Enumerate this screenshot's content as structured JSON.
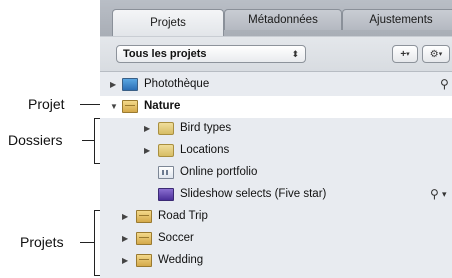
{
  "annotations": {
    "projet": "Projet",
    "dossiers": "Dossiers",
    "projets": "Projets"
  },
  "tabs": [
    {
      "label": "Projets",
      "active": true
    },
    {
      "label": "Métadonnées",
      "active": false
    },
    {
      "label": "Ajustements",
      "active": false
    }
  ],
  "toolbar": {
    "selector_value": "Tous les projets",
    "add_label": "+",
    "action_label": "⚙"
  },
  "list": {
    "items": [
      {
        "label": "Photothèque",
        "icon": "library-icon",
        "expanded": false,
        "has_search": true
      },
      {
        "label": "Nature",
        "icon": "project-icon",
        "expanded": true,
        "selected": true
      },
      {
        "label": "Bird types",
        "icon": "folder-icon",
        "expanded": false
      },
      {
        "label": "Locations",
        "icon": "folder-icon",
        "expanded": false
      },
      {
        "label": "Online portfolio",
        "icon": "album-icon"
      },
      {
        "label": "Slideshow selects (Five star)",
        "icon": "smart-slideshow-icon",
        "has_search": true
      },
      {
        "label": "Road Trip",
        "icon": "project-icon",
        "expanded": false
      },
      {
        "label": "Soccer",
        "icon": "project-icon",
        "expanded": false
      },
      {
        "label": "Wedding",
        "icon": "project-icon",
        "expanded": false
      }
    ]
  }
}
